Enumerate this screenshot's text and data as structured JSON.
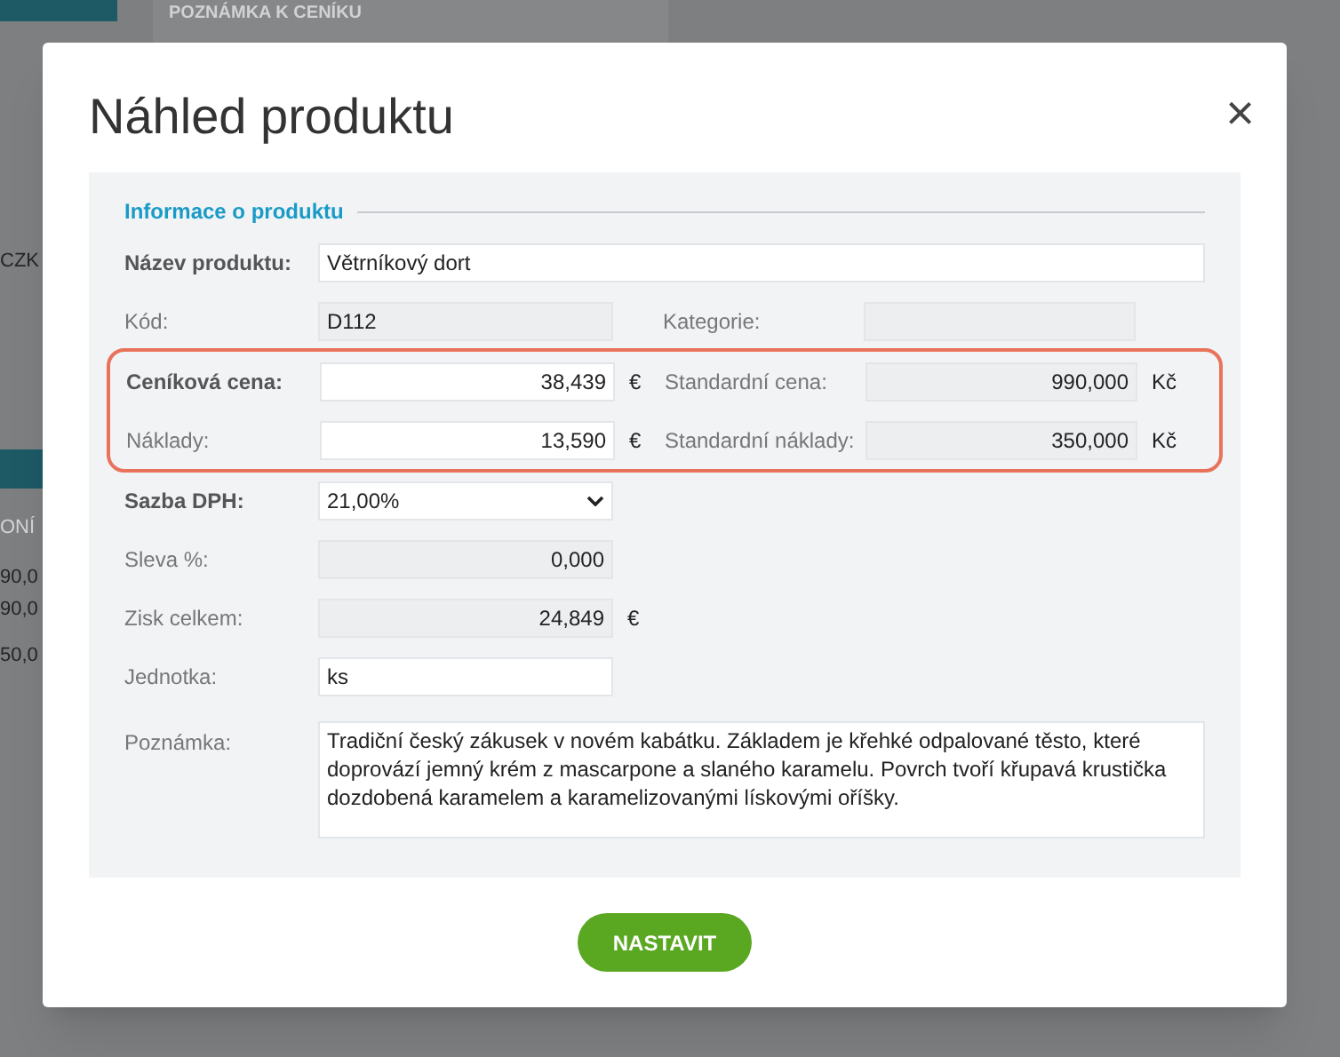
{
  "background": {
    "heading": "POZNÁMKA K CENÍKU",
    "fragments": [
      "CZK",
      "ONÍ",
      "90,0",
      "90,0",
      "50,0"
    ]
  },
  "dialog": {
    "title": "Náhled produktu",
    "close": "×",
    "section": "Informace o produktu",
    "rows": [
      {
        "highlighted": false,
        "left": {
          "label": "Název produktu:",
          "required": true,
          "kind": "wide-text",
          "value": "Větrníkový dort"
        }
      },
      {
        "highlighted": false,
        "left": {
          "label": "Kód:",
          "required": false,
          "kind": "readonly-text",
          "value": "D112"
        },
        "right": {
          "label": "Kategorie:",
          "kind": "readonly-text"
        }
      },
      {
        "highlighted": true,
        "left": {
          "label": "Ceníková cena:",
          "required": true,
          "kind": "number",
          "value": "38,439",
          "unit": "€"
        },
        "right": {
          "label": "Standardní cena:",
          "kind": "readonly-number",
          "value": "990,000",
          "unit": "Kč"
        }
      },
      {
        "highlighted": true,
        "left": {
          "label": "Náklady:",
          "required": false,
          "kind": "number",
          "value": "13,590",
          "unit": "€"
        },
        "right": {
          "label": "Standardní náklady:",
          "kind": "readonly-number",
          "value": "350,000",
          "unit": "Kč"
        }
      },
      {
        "highlighted": false,
        "left": {
          "label": "Sazba DPH:",
          "required": true,
          "kind": "select",
          "value": "21,00%"
        }
      },
      {
        "highlighted": false,
        "left": {
          "label": "Sleva %:",
          "required": false,
          "kind": "readonly-number",
          "value": "0,000"
        }
      },
      {
        "highlighted": false,
        "left": {
          "label": "Zisk celkem:",
          "required": false,
          "kind": "readonly-number",
          "value": "24,849",
          "unit": "€"
        }
      },
      {
        "highlighted": false,
        "left": {
          "label": "Jednotka:",
          "required": false,
          "kind": "text",
          "value": "ks"
        }
      }
    ],
    "note": {
      "label": "Poznámka:",
      "value": "Tradiční český zákusek v novém kabátku. Základem je křehké odpalované těsto, které doprovází jemný krém z mascarpone a slaného karamelu. Povrch tvoří křupavá krustička dozdobená karamelem a karamelizovanými lískovými oříšky."
    },
    "button": "NASTAVIT"
  }
}
